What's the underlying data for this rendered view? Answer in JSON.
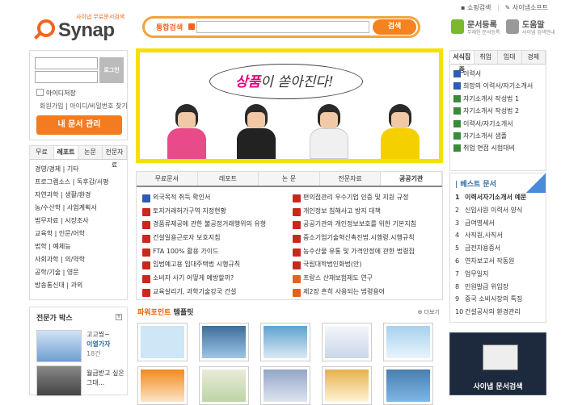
{
  "header": {
    "logo_tagline": "사이냅 무료문서검색",
    "logo_name": "Synap",
    "search_scope": "통합검색",
    "search_value": "",
    "search_button": "검색",
    "top_links": [
      "쇼핑검색",
      "사이냅소프트"
    ],
    "doc_register": {
      "title": "문서등록",
      "sub": "무제한 문서등록"
    },
    "help": {
      "title": "도움말",
      "sub": "사이냅 검색안내"
    }
  },
  "login": {
    "login_button": "로그인",
    "save_id": "아이디저장",
    "links": "회원가입 | 아이디/비밀번호 찾기",
    "my_docs": "내 문서 관리"
  },
  "category": {
    "tabs": [
      "무료",
      "레포트",
      "논문",
      "전문자료"
    ],
    "active_tab": 1,
    "items": [
      "경영/경제 | 기타",
      "프로그램소스 | 독후감/서평",
      "자연과학 | 생활/환경",
      "농/수산학 | 사업계획서",
      "법무자료 | 시장조사",
      "교육학 | 인문/어학",
      "법학 | 예체능",
      "사회과학 | 의/약학",
      "공학/기술 | 영문",
      "방송통신대 | 과외"
    ]
  },
  "expert": {
    "title": "전문가 박스",
    "items": [
      {
        "line1": "고고씽~",
        "line2": "이열가자",
        "line3": "18건"
      },
      {
        "line1": "월급받고 싶은",
        "line2": "그대..."
      }
    ]
  },
  "banner": {
    "text_pre": "",
    "text_hl": "상품",
    "text_post": "이 쏟아진다!"
  },
  "news": {
    "tabs": [
      "무료문서",
      "레포트",
      "논 문",
      "전문자료",
      "공공기관"
    ],
    "active_tab": 4,
    "left": [
      {
        "icon": "word",
        "text": "외국목적 취득 확인서"
      },
      {
        "icon": "pdf",
        "text": "토지거래허가구역 지정현황"
      },
      {
        "icon": "pdf",
        "text": "경품류제공에 관한 불공정거래행위의 유형"
      },
      {
        "icon": "pdf",
        "text": "건설일용근로자 보호지침"
      },
      {
        "icon": "pdf",
        "text": "FTA 100% 활용 가이드"
      },
      {
        "icon": "pdf",
        "text": "임법예고용 임대주택법 시행규칙"
      },
      {
        "icon": "pdf",
        "text": "소비자 사기 어떻게 예방할까?"
      },
      {
        "icon": "pdf",
        "text": "교육살리기, 과학기술강국 건설"
      }
    ],
    "right": [
      {
        "icon": "pdf",
        "text": "편의점관리 우수기업 인증 및 지원 규정"
      },
      {
        "icon": "pdf",
        "text": "개인정보 침해사고 방지 대책"
      },
      {
        "icon": "pdf",
        "text": "공공기관의 개인정보보호를 위한 기본지침"
      },
      {
        "icon": "pdf",
        "text": "중소기업기술혁신촉진법.시행령.시행규칙"
      },
      {
        "icon": "pdf",
        "text": "농수산물 유통 및 가격안정에 관한 법령집"
      },
      {
        "icon": "pdf",
        "text": "국립대학법인화법(안)"
      },
      {
        "icon": "ppt",
        "text": "프랑스 산재보험제도 연구"
      },
      {
        "icon": "ppt",
        "text": "제2장 흔히 사용되는 법령용어"
      }
    ]
  },
  "ppt": {
    "title_a": "파워포인트",
    "title_b": " 템플릿",
    "more": "더보기",
    "thumbs": [
      "#cde7f7",
      "#3d6e9a",
      "#5fa3cf",
      "#c9d7e8",
      "#a8d1ee",
      "#4a7fae",
      "#e9ecd7",
      "#f28b1e",
      "#bcd4a6",
      "#93a6c8",
      "#e6b24d",
      "#7db7e6"
    ]
  },
  "right_tabs": {
    "tabs": [
      "서식집중",
      "취업",
      "임대",
      "경제"
    ],
    "active_tab": 0,
    "items": [
      "이력서",
      "희망의 이력서/자기소개서",
      "자기소개서 작성법 1",
      "자기소개서 작성법 2",
      "이력서/자기소개서",
      "자기소개서 샘플",
      "취업 면접 시험대비"
    ]
  },
  "best": {
    "title": "베스트 문서",
    "items": [
      "이력서자기소개서 예문",
      "신입사원 이력서 양식",
      "급여명세서",
      "사직원,사직서",
      "금전차용증서",
      "연차보고서 작동원",
      "업무일지",
      "민원발급 위임장",
      "중국 소비시장의 특징",
      "건설공사의 환경관리"
    ]
  },
  "ad": {
    "caption": "사이냅 문서검색"
  }
}
